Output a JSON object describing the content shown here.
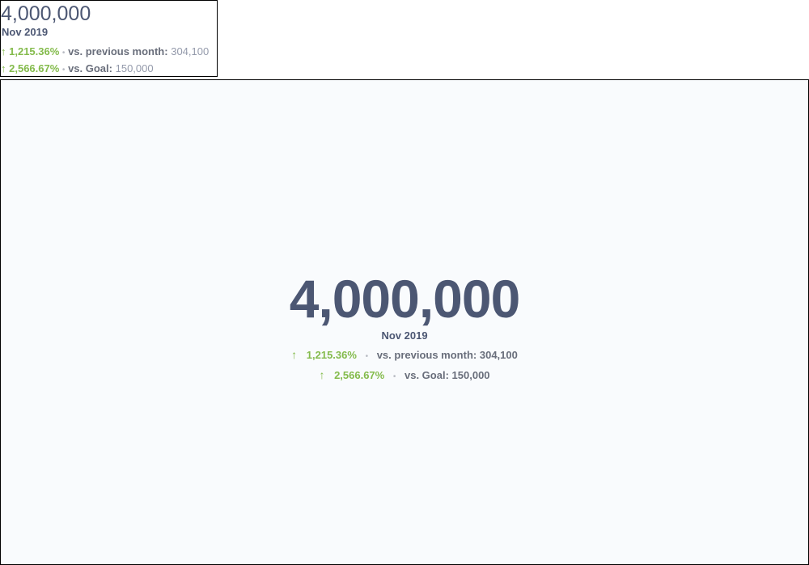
{
  "small_card": {
    "value": "4,000,000",
    "period": "Nov 2019",
    "comparisons": [
      {
        "arrow": "↑",
        "percent": "1,215.36%",
        "separator": "•",
        "label": "vs. previous month:",
        "value": "304,100"
      },
      {
        "arrow": "↑",
        "percent": "2,566.67%",
        "separator": "•",
        "label": "vs. Goal:",
        "value": "150,000"
      }
    ]
  },
  "big_card": {
    "value": "4,000,000",
    "period": "Nov 2019",
    "comparisons": [
      {
        "arrow": "↑",
        "percent": "1,215.36%",
        "separator": "•",
        "label": "vs. previous month:",
        "value": "304,100"
      },
      {
        "arrow": "↑",
        "percent": "2,566.67%",
        "separator": "•",
        "label": "vs. Goal:",
        "value": "150,000"
      }
    ]
  },
  "colors": {
    "primary_text": "#4c5773",
    "positive": "#84bb4c",
    "muted": "#696e7b",
    "background": "#f9fbfd"
  },
  "icons": {
    "trend": "arrow-up-icon"
  }
}
